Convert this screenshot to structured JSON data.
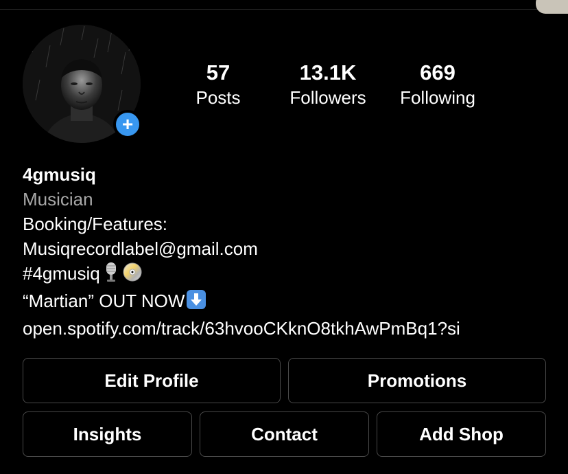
{
  "profile": {
    "stats": {
      "posts_count": "57",
      "posts_label": "Posts",
      "followers_count": "13.1K",
      "followers_label": "Followers",
      "following_count": "669",
      "following_label": "Following"
    },
    "add_badge_symbol": "+",
    "bio": {
      "name": "4gmusiq",
      "category": "Musician",
      "line1": "Booking/Features:",
      "line2": "Musiqrecordlabel@gmail.com",
      "line3_text": "#4gmusiq",
      "line4_text": "“Martian” OUT NOW",
      "link": "open.spotify.com/track/63hvooCKknO8tkhAwPmBq1?si"
    }
  },
  "buttons": {
    "edit_profile": "Edit Profile",
    "promotions": "Promotions",
    "insights": "Insights",
    "contact": "Contact",
    "add_shop": "Add Shop"
  },
  "colors": {
    "background": "#000000",
    "badge_blue": "#3897f0",
    "muted_text": "#a8a8a8",
    "button_border": "#4a4a4a"
  },
  "icons": {
    "emoji_1": "microphone-icon",
    "emoji_2": "cd-disc-icon",
    "emoji_3": "down-arrow-icon"
  }
}
